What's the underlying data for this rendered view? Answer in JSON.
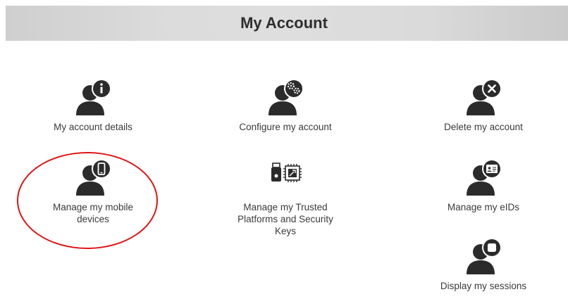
{
  "header": {
    "title": "My Account"
  },
  "tiles": [
    {
      "label": "My account details",
      "icon": "user-info-icon"
    },
    {
      "label": "Configure my account",
      "icon": "user-gears-icon"
    },
    {
      "label": "Delete my account",
      "icon": "user-delete-icon"
    },
    {
      "label": "Manage my mobile devices",
      "label_lines": [
        "Manage my mobile",
        "devices"
      ],
      "icon": "user-mobile-icon"
    },
    {
      "label": "Manage my Trusted Platforms and Security Keys",
      "label_lines": [
        "Manage my Trusted",
        "Platforms and Security",
        "Keys"
      ],
      "icon": "security-key-chip-icon"
    },
    {
      "label": "Manage my eIDs",
      "icon": "user-eid-card-icon"
    },
    {
      "label": "Display my sessions",
      "icon": "user-sessions-icon"
    }
  ],
  "colors": {
    "icon": "#2b2b2b",
    "highlight": "#e01414",
    "header_bg": "#d8d8d8"
  }
}
